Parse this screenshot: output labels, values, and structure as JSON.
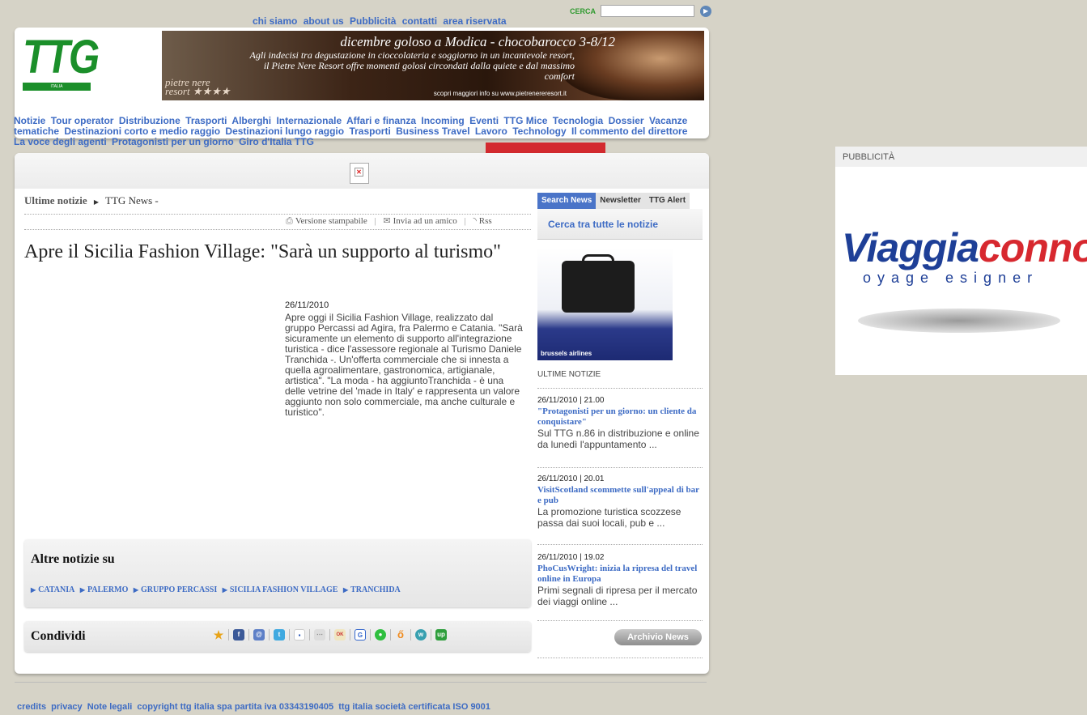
{
  "top_links": [
    "chi siamo",
    "about us",
    "Pubblicità",
    "contatti",
    "area riservata"
  ],
  "search": {
    "label": "CERCA",
    "value": ""
  },
  "logo": {
    "text": "TTG",
    "sub": "ITALIA"
  },
  "banner": {
    "title": "dicembre goloso a Modica - chocobarocco 3-8/12",
    "text": "Agli indecisi tra degustazione in cioccolateria  e soggiorno in un incantevole resort, il Pietre Nere Resort offre momenti golosi circondati dalla quiete e dal massimo comfort",
    "foot": "scopri maggiori info su www.pietrenereresort.it",
    "brand_line1": "pietre nere",
    "brand_line2": "resort ★★★★"
  },
  "nav": [
    "Notizie",
    "Tour operator",
    "Distribuzione",
    "Trasporti",
    "Alberghi",
    "Internazionale",
    "Affari e finanza",
    "Incoming",
    "Eventi",
    "TTG Mice",
    "Tecnologia",
    "Dossier",
    "Vacanze tematiche",
    "Destinazioni corto e medio raggio",
    "Destinazioni lungo raggio",
    "Trasporti",
    "Business Travel",
    "Lavoro",
    "Technology",
    "Il commento del direttore",
    "La voce degli agenti",
    "Protagonisti per un giorno",
    "Giro d'Italia TTG"
  ],
  "breadcrumb": {
    "first": "Ultime notizie",
    "second": "TTG News -"
  },
  "tools": {
    "print": "Versione stampabile",
    "send": "Invia ad un amico",
    "rss": "Rss"
  },
  "article": {
    "title": "Apre il Sicilia Fashion Village: \"Sarà un supporto al turismo\"",
    "date": "26/11/2010",
    "body": "Apre oggi il Sicilia Fashion Village, realizzato dal gruppo Percassi ad Agira, fra Palermo e Catania. \"Sarà sicuramente un elemento di supporto all'integrazione turistica - dice l'assessore regionale al Turismo Daniele Tranchida -. Un'offerta commerciale che si innesta a quella agroalimentare, gastronomica, artigianale, artistica\". \"La moda - ha aggiuntoTranchida - è una delle vetrine del 'made in Italy' e rappresenta un valore aggiunto non solo commerciale, ma anche culturale e turistico\"."
  },
  "altre": {
    "title": "Altre notizie su",
    "tags": [
      "CATANIA",
      "PALERMO",
      "GRUPPO PERCASSI",
      "SICILIA FASHION VILLAGE",
      "TRANCHIDA"
    ]
  },
  "condividi": {
    "title": "Condividi"
  },
  "sidebar": {
    "tabs": [
      "Search News",
      "Newsletter",
      "TTG Alert"
    ],
    "cerca": "Cerca tra tutte le notizie",
    "ad_text": "brussels airlines",
    "ultime_label": "ULTIME NOTIZIE",
    "news": [
      {
        "date": "26/11/2010 | 21.00",
        "title": "\"Protagonisti per un giorno: un cliente da conquistare\"",
        "summary": "Sul TTG n.86 in distribuzione e online da lunedì l'appuntamento ..."
      },
      {
        "date": "26/11/2010 | 20.01",
        "title": "VisitScotland scommette sull'appeal di bar e pub",
        "summary": "La promozione turistica scozzese passa dai suoi locali, pub e ..."
      },
      {
        "date": "26/11/2010 | 19.02",
        "title": "PhoCusWright: inizia la ripresa del travel online in Europa",
        "summary": "Primi segnali di ripresa per il mercato dei viaggi online ..."
      }
    ],
    "archivio": "Archivio News"
  },
  "footer": [
    "credits",
    "privacy",
    "Note legali",
    "copyright ttg italia spa partita iva 03343190405",
    "ttg italia società certificata ISO 9001"
  ],
  "pub": {
    "label": "PUBBLICITÀ",
    "logo_a": "Viaggia",
    "logo_b": "connoi",
    "logo_sub": "oyage  esigner"
  },
  "colors": {
    "link": "#3d6bc4",
    "brand_green": "#1b8f2a",
    "accent_red": "#d32a2f",
    "background": "#d6d3c7"
  }
}
